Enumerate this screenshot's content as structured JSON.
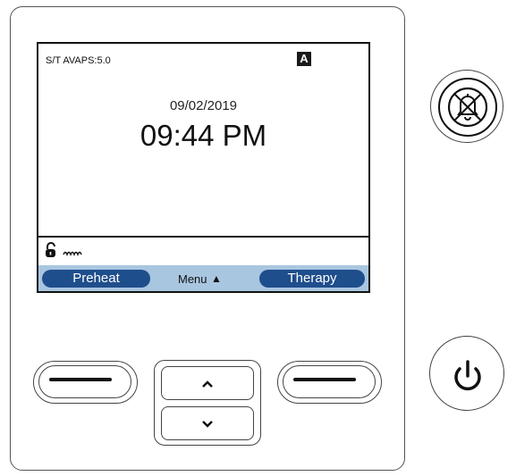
{
  "screen": {
    "mode_label": "S/T AVAPS:5.0",
    "badge": "A",
    "date": "09/02/2019",
    "time": "09:44 PM",
    "status_icons": [
      "unlock-icon",
      "humidifier-icon"
    ],
    "softkeys": {
      "left": "Preheat",
      "center": "Menu",
      "center_icon": "▲",
      "right": "Therapy"
    },
    "colors": {
      "softkey_bar": "#a9c6e0",
      "softkey_pill": "#1f4e8c"
    }
  },
  "hardware": {
    "left_key_icon": "dash-icon",
    "right_key_icon": "dash-icon",
    "up_icon": "chevron-up-icon",
    "down_icon": "chevron-down-icon",
    "alarm_icon": "alarm-silence-icon",
    "power_icon": "power-icon"
  }
}
